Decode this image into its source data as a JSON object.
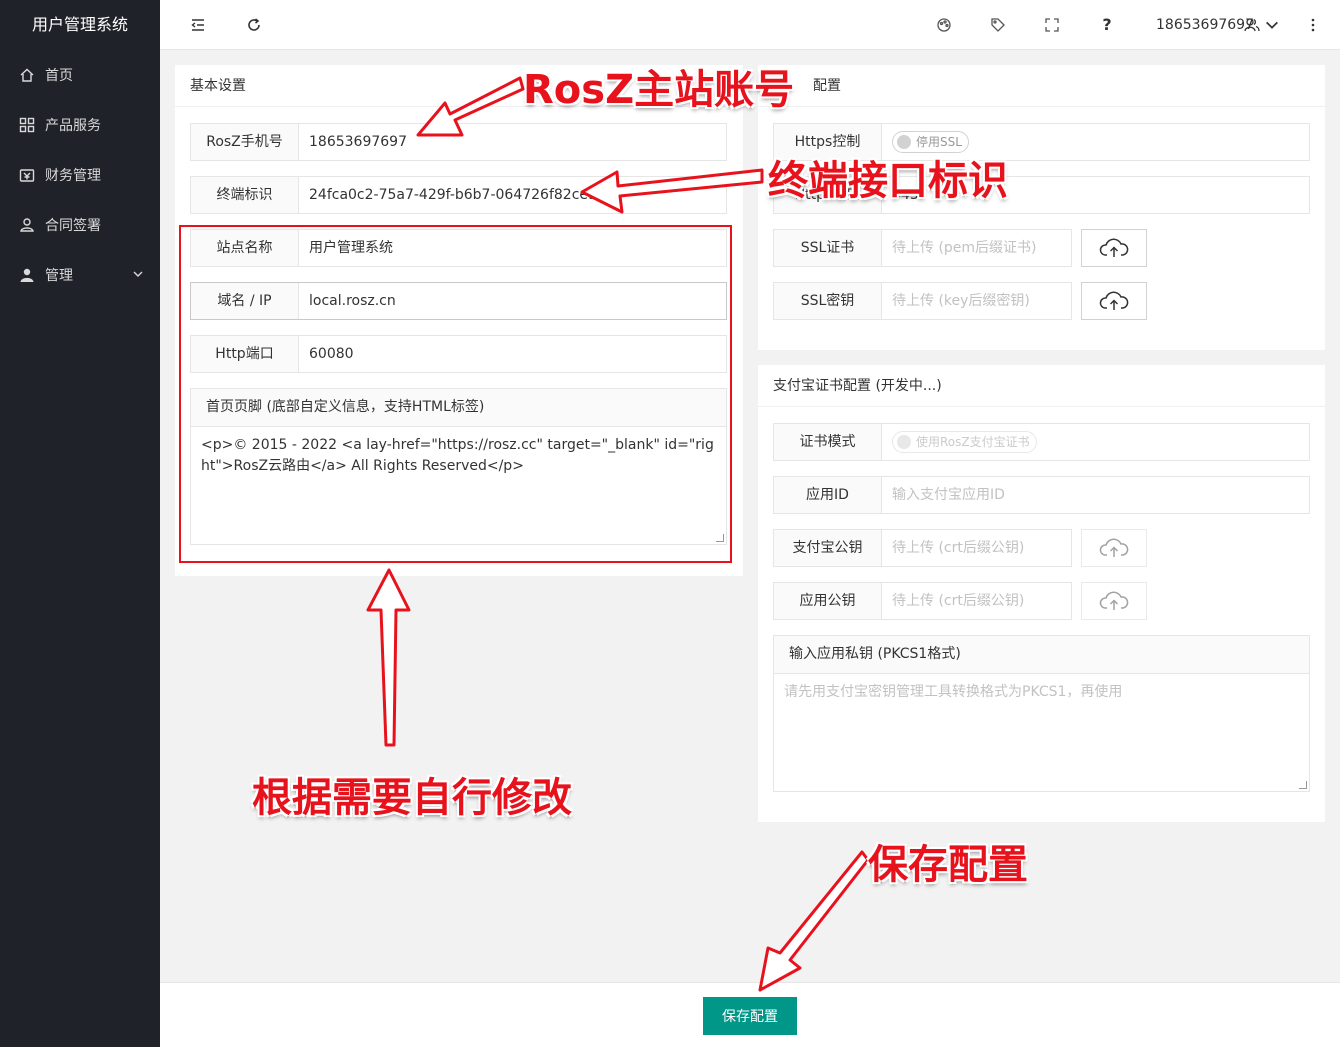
{
  "app": {
    "title": "用户管理系统"
  },
  "sidebar": {
    "items": [
      {
        "label": "首页",
        "icon": "home-icon"
      },
      {
        "label": "产品服务",
        "icon": "apps-icon"
      },
      {
        "label": "财务管理",
        "icon": "finance-icon"
      },
      {
        "label": "合同签署",
        "icon": "contract-icon"
      },
      {
        "label": "管理",
        "icon": "user-icon"
      }
    ]
  },
  "topbar": {
    "help": "?",
    "user": "18653697697"
  },
  "basic": {
    "title": "基本设置",
    "phone": {
      "label": "RosZ手机号",
      "value": "18653697697"
    },
    "terminal": {
      "label": "终端标识",
      "value": "24fca0c2-75a7-429f-b6b7-064726f82ce9"
    },
    "site": {
      "label": "站点名称",
      "value": "用户管理系统"
    },
    "domain": {
      "label": "域名 / IP",
      "value": "local.rosz.cn"
    },
    "port": {
      "label": "Http端口",
      "value": "60080"
    },
    "footer": {
      "label": "首页页脚 (底部自定义信息，支持HTML标签)",
      "value": "<p>© 2015 - 2022 <a lay-href=\"https://rosz.cc\" target=\"_blank\" id=\"right\">RosZ云路由</a> All Rights Reserved</p>"
    }
  },
  "https": {
    "title": "配置",
    "control": {
      "label": "Https控制",
      "switch": "停用SSL"
    },
    "port": {
      "label": "Https端口",
      "value": "443"
    },
    "cert": {
      "label": "SSL证书",
      "placeholder": "待上传 (pem后缀证书)"
    },
    "key": {
      "label": "SSL密钥",
      "placeholder": "待上传 (key后缀密钥)"
    }
  },
  "alipay": {
    "title": "支付宝证书配置 (开发中...)",
    "mode": {
      "label": "证书模式",
      "switch": "使用RosZ支付宝证书"
    },
    "appid": {
      "label": "应用ID",
      "placeholder": "输入支付宝应用ID"
    },
    "alipay_pub": {
      "label": "支付宝公钥",
      "placeholder": "待上传 (crt后缀公钥)"
    },
    "app_pub": {
      "label": "应用公钥",
      "placeholder": "待上传 (crt后缀公钥)"
    },
    "private_key": {
      "label": "输入应用私钥 (PKCS1格式)",
      "placeholder": "请先用支付宝密钥管理工具转换格式为PKCS1，再使用"
    }
  },
  "footer": {
    "save_label": "保存配置"
  },
  "annotations": {
    "account": "RosZ主站账号",
    "terminal": "终端接口标识",
    "modify": "根据需要自行修改",
    "save": "保存配置"
  },
  "colors": {
    "accent": "#009688",
    "sidebar": "#20222a",
    "annotation": "#e8121c"
  }
}
